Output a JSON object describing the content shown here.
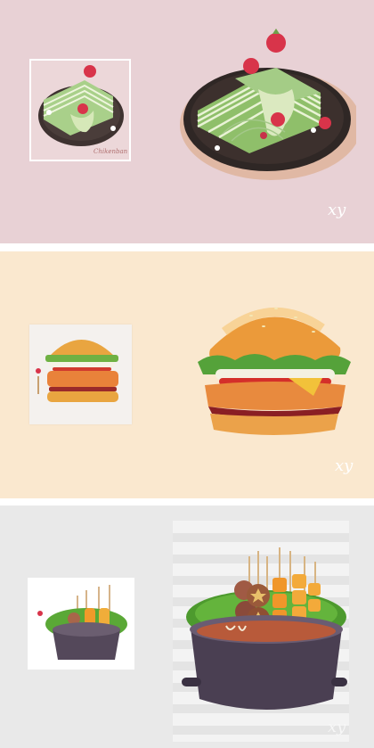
{
  "panels": [
    {
      "name": "matcha crepe cake",
      "thumb_caption": "Chikenban",
      "signature": "xy"
    },
    {
      "name": "chicken burger",
      "signature": "xy"
    },
    {
      "name": "skewer hot pot",
      "signature": "xy"
    }
  ],
  "colors": {
    "panel1_bg": "#e8d1d5",
    "panel2_bg": "#fae8cf",
    "panel3_bg": "#e9e9e9",
    "matcha": "#8fbf6a",
    "strawberry": "#d8344a",
    "bun": "#e9a540",
    "pot": "#5a4a5e"
  }
}
